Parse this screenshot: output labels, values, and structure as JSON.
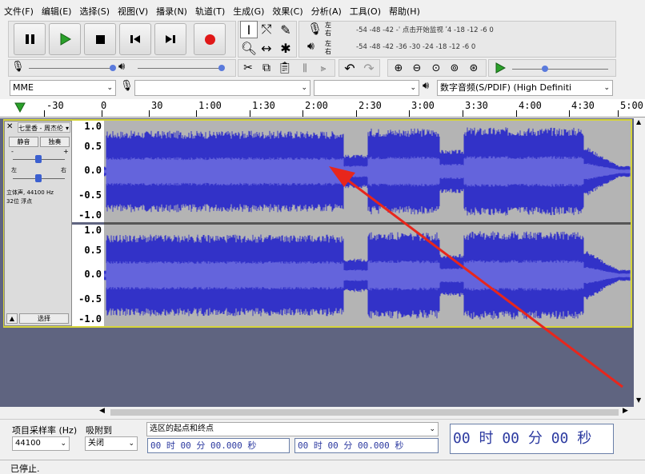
{
  "menu": [
    "文件(F)",
    "编辑(E)",
    "选择(S)",
    "视图(V)",
    "播录(N)",
    "轨道(T)",
    "生成(G)",
    "效果(C)",
    "分析(A)",
    "工具(O)",
    "帮助(H)"
  ],
  "meters": {
    "rec_ticks": "-54    -48    -42    -ˈ 点击开始监视 ʹ4    -18    -12    -6    0",
    "play_ticks": "-54    -48    -42    -36    -30    -24    -18    -12    -6    0",
    "left": "左",
    "right": "右"
  },
  "devices": {
    "host": "MME",
    "output": "数字音频(S/PDIF) (High Definiti"
  },
  "ruler": [
    "-30",
    "0",
    "30",
    "1:00",
    "1:30",
    "2:00",
    "2:30",
    "3:00",
    "3:30",
    "4:00",
    "4:30",
    "5:00"
  ],
  "track": {
    "name": "七里香 - 周杰伦",
    "mute": "静音",
    "solo": "独奏",
    "gain_left": "L",
    "gain_right": "R",
    "pan_left": "左",
    "pan_right": "右",
    "info1": "立体声, 44100 Hz",
    "info2": "32位 浮点",
    "select": "选择"
  },
  "scale": [
    "1.0",
    "0.5",
    "0.0",
    "-0.5",
    "-1.0"
  ],
  "colors": {
    "wave": "#3232c8",
    "rms": "#6464dc",
    "bg": "#5f6480",
    "arrow": "#e8261c"
  },
  "bottom": {
    "rate_label": "项目采样率 (Hz)",
    "rate_value": "44100",
    "snap_label": "吸附到",
    "snap_value": "关闭",
    "sel_mode": "选区的起点和终点",
    "sel_start": "00 时 00 分 00.000 秒",
    "sel_end": "00 时 00 分 00.000 秒",
    "position": "00 时 00 分 00 秒"
  },
  "status": "已停止."
}
